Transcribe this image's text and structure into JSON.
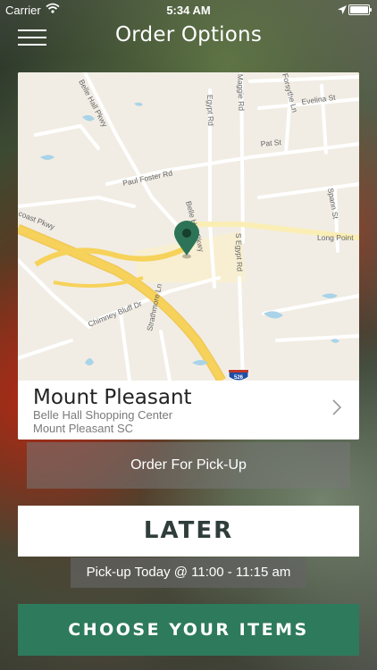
{
  "status_bar": {
    "carrier": "Carrier",
    "time": "5:34 AM"
  },
  "header": {
    "title": "Order Options"
  },
  "map": {
    "street_labels": [
      "Belle Hall Pkwy",
      "Egypt Rd",
      "Maggie Rd",
      "Forsythe Ln",
      "Evelina St",
      "Pat St",
      "Paul Foster Rd",
      "Spann St",
      "Belle Hall Pkwy",
      "Long Point",
      "coast Pkwy",
      "S Egypt Rd",
      "Chimney Bluff Dr",
      "Strathmore Ln",
      "526"
    ]
  },
  "location": {
    "name": "Mount Pleasant",
    "line1": "Belle Hall Shopping Center",
    "line2": "Mount Pleasant SC"
  },
  "buttons": {
    "order_pickup": "Order For Pick-Up",
    "later": "LATER",
    "choose_items": "CHOOSE YOUR ITEMS"
  },
  "pickup_time": "Pick-up Today @ 11:00 - 11:15 am",
  "colors": {
    "primary_green": "#2e7a5c",
    "map_marker": "#2c7357",
    "highway": "#f6d25a"
  }
}
